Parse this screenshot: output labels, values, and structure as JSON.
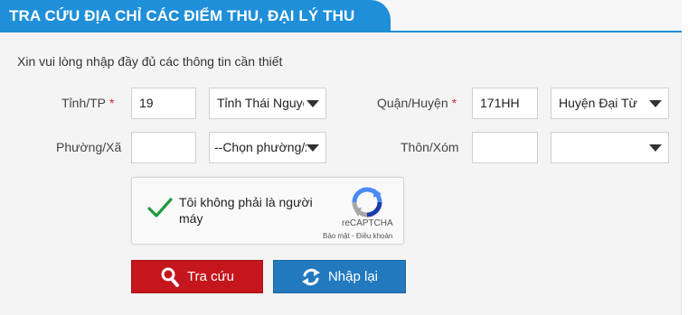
{
  "header": {
    "title": "TRA CỨU ĐỊA CHỈ CÁC ĐIỂM THU, ĐẠI LÝ THU"
  },
  "intro": "Xin vui lòng nhập đầy đủ các thông tin cần thiết",
  "form": {
    "province": {
      "label": "Tỉnh/TP",
      "required_mark": "*",
      "code": "19",
      "selected": "Tỉnh Thái Nguyên"
    },
    "district": {
      "label": "Quận/Huyện",
      "required_mark": "*",
      "code": "171HH",
      "selected": "Huyện Đại Từ"
    },
    "ward": {
      "label": "Phường/Xã",
      "code": "",
      "selected": "--Chọn phường/xã--"
    },
    "hamlet": {
      "label": "Thôn/Xóm",
      "code": "",
      "selected": ""
    }
  },
  "captcha": {
    "checked": true,
    "label": "Tôi không phải là người máy",
    "brand": "reCAPTCHA",
    "links": "Bảo mật - Điều khoản"
  },
  "buttons": {
    "search": "Tra cứu",
    "reset": "Nhập lại"
  },
  "colors": {
    "header": "#1e8fd8",
    "search_button": "#c4161c",
    "reset_button": "#2279be",
    "check": "#1e9a3e",
    "required": "#d9262a"
  },
  "icons": {
    "check": "check-icon",
    "recaptcha": "recaptcha-logo-icon",
    "search": "search-icon",
    "reset": "refresh-icon",
    "dropdown": "chevron-down-icon"
  }
}
